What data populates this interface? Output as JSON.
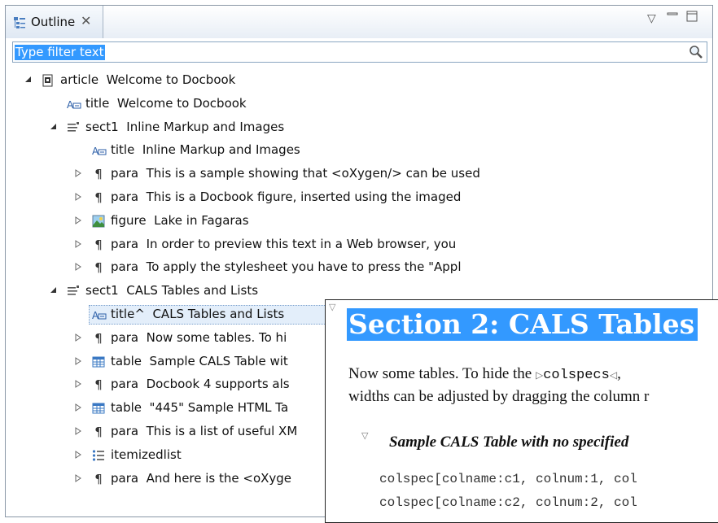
{
  "view": {
    "tab_label": "Outline",
    "close_glyph": "✕",
    "menu_glyph": "▽",
    "minimize_glyph": "▭",
    "maximize_glyph": "□"
  },
  "filter": {
    "value": "Type filter text"
  },
  "tree": [
    {
      "tag": "article",
      "text": "Welcome to Docbook",
      "icon": "document-icon",
      "twisty": "expanded"
    },
    {
      "tag": "title",
      "text": "Welcome to Docbook",
      "icon": "title-icon",
      "twisty": "none"
    },
    {
      "tag": "sect1",
      "text": "Inline Markup and Images",
      "icon": "section-icon",
      "twisty": "expanded"
    },
    {
      "tag": "title",
      "text": "Inline Markup and Images",
      "icon": "title-icon",
      "twisty": "none"
    },
    {
      "tag": "para",
      "text": "This is a sample showing that <oXygen/> can be used",
      "icon": "pilcrow-icon",
      "twisty": "collapsed"
    },
    {
      "tag": "para",
      "text": "This is a Docbook figure, inserted using the imaged",
      "icon": "pilcrow-icon",
      "twisty": "collapsed"
    },
    {
      "tag": "figure",
      "text": "Lake in Fagaras",
      "icon": "image-icon",
      "twisty": "collapsed"
    },
    {
      "tag": "para",
      "text": "In order to preview this text in a Web browser, you",
      "icon": "pilcrow-icon",
      "twisty": "collapsed"
    },
    {
      "tag": "para",
      "text": "To apply the stylesheet you have to press the \"Appl",
      "icon": "pilcrow-icon",
      "twisty": "collapsed"
    },
    {
      "tag": "sect1",
      "text": "CALS Tables and Lists",
      "icon": "section-icon",
      "twisty": "expanded"
    },
    {
      "tag": "title^",
      "text": "CALS Tables and Lists",
      "icon": "title-icon",
      "twisty": "none",
      "selected": true
    },
    {
      "tag": "para",
      "text": "Now some tables. To hi",
      "icon": "pilcrow-icon",
      "twisty": "collapsed"
    },
    {
      "tag": "table",
      "text": "Sample CALS Table wit",
      "icon": "table-icon",
      "twisty": "collapsed"
    },
    {
      "tag": "para",
      "text": "Docbook 4 supports als",
      "icon": "pilcrow-icon",
      "twisty": "collapsed"
    },
    {
      "tag": "table",
      "text": "\"445\" Sample HTML Ta",
      "icon": "table-icon",
      "twisty": "collapsed"
    },
    {
      "tag": "para",
      "text": "This is a list of useful XM",
      "icon": "pilcrow-icon",
      "twisty": "collapsed"
    },
    {
      "tag": "itemizedlist",
      "text": "",
      "icon": "list-icon",
      "twisty": "collapsed"
    },
    {
      "tag": "para",
      "text": "And here is the <oXyge",
      "icon": "pilcrow-icon",
      "twisty": "collapsed"
    }
  ],
  "preview": {
    "heading": "Section 2: CALS Tables",
    "para1_prefix": "Now some tables. To hide the ",
    "para1_open_mark": "▷",
    "para1_code": "colspecs",
    "para1_close_mark": "◁",
    "para1_suffix": ",",
    "para2": "widths can be adjusted by dragging the column r",
    "table_caption": "Sample CALS Table with no specified",
    "code_lines": [
      "colspec[colname:c1, colnum:1, col",
      "colspec[colname:c2, colnum:2, col"
    ]
  }
}
